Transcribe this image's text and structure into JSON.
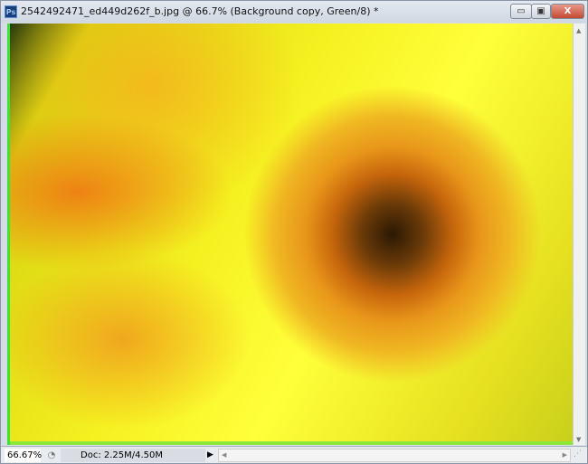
{
  "window": {
    "title": "2542492471_ed449d262f_b.jpg @ 66.7% (Background copy, Green/8) *",
    "app_icon": "Ps",
    "minimize": "▭",
    "maximize": "▣",
    "close": "X"
  },
  "status": {
    "zoom": "66.67%",
    "doc": "Doc: 2.25M/4.50M",
    "menu_arrow": "▶"
  }
}
